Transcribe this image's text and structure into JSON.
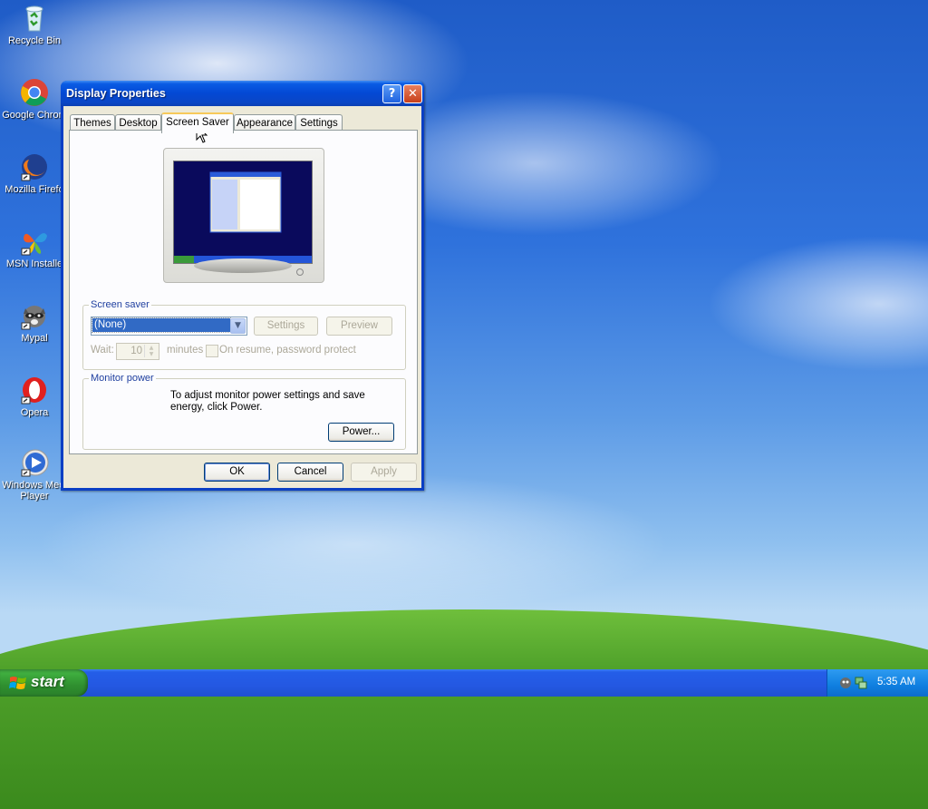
{
  "desktop": {
    "icons": [
      {
        "label": "Recycle Bin"
      },
      {
        "label": "Google Chrom"
      },
      {
        "label": "Mozilla Firefo"
      },
      {
        "label": "MSN Installe"
      },
      {
        "label": "Mypal"
      },
      {
        "label": "Opera"
      },
      {
        "label": "Windows Medi Player"
      }
    ]
  },
  "window": {
    "title": "Display Properties",
    "help_label": "?",
    "close_label": "✕",
    "tabs": [
      {
        "label": "Themes"
      },
      {
        "label": "Desktop"
      },
      {
        "label": "Screen Saver",
        "active": true
      },
      {
        "label": "Appearance"
      },
      {
        "label": "Settings"
      }
    ],
    "screen_saver": {
      "group_label": "Screen saver",
      "selected": "(None)",
      "settings_label": "Settings",
      "preview_label": "Preview",
      "wait_label": "Wait:",
      "wait_value": "10",
      "minutes_label": "minutes",
      "password_label": "On resume, password protect"
    },
    "monitor_power": {
      "group_label": "Monitor power",
      "text": "To adjust monitor power settings and save energy, click Power.",
      "power_label": "Power..."
    },
    "ok_label": "OK",
    "cancel_label": "Cancel",
    "apply_label": "Apply"
  },
  "taskbar": {
    "start_label": "start",
    "clock": "5:35 AM"
  },
  "colors": {
    "title_bar": "#0348d4",
    "selection": "#316ac5",
    "dialog_bg": "#ece9d8",
    "start_green": "#3fae3f"
  }
}
